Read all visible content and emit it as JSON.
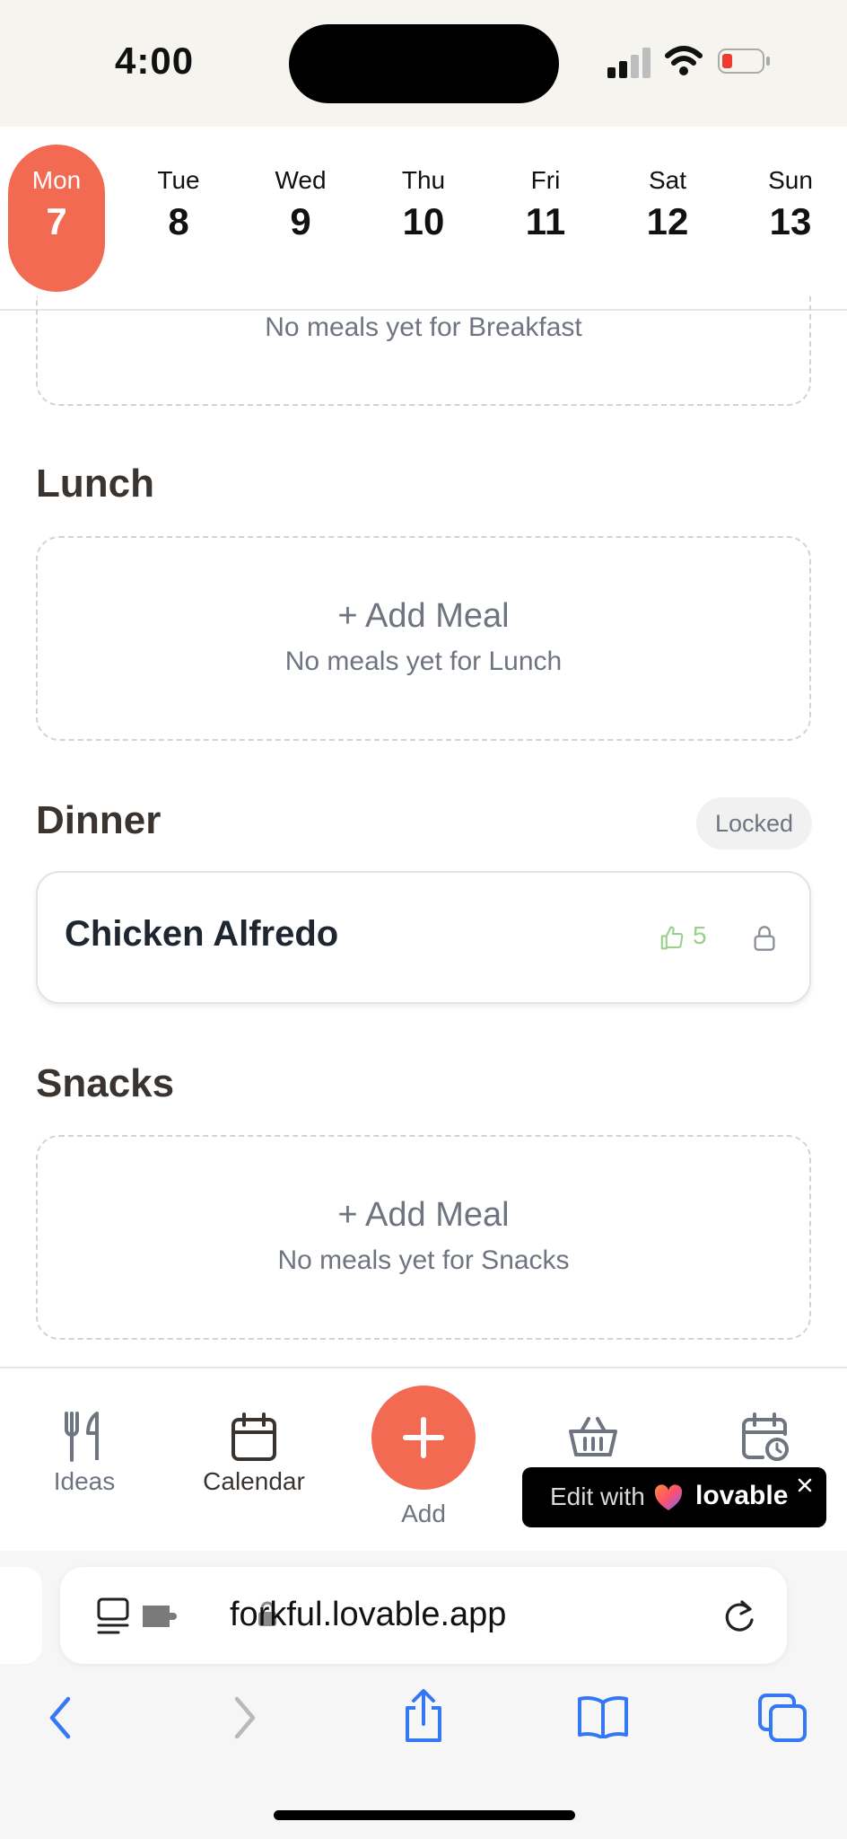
{
  "status_bar": {
    "time": "4:00"
  },
  "week": {
    "days": [
      {
        "name": "Mon",
        "num": "7",
        "active": true
      },
      {
        "name": "Tue",
        "num": "8"
      },
      {
        "name": "Wed",
        "num": "9"
      },
      {
        "name": "Thu",
        "num": "10"
      },
      {
        "name": "Fri",
        "num": "11"
      },
      {
        "name": "Sat",
        "num": "12"
      },
      {
        "name": "Sun",
        "num": "13"
      }
    ]
  },
  "breakfast": {
    "empty_text": "No meals yet for Breakfast"
  },
  "lunch": {
    "title": "Lunch",
    "add_label": "+ Add Meal",
    "empty_text": "No meals yet for Lunch"
  },
  "dinner": {
    "title": "Dinner",
    "badge": "Locked",
    "meal": {
      "name": "Chicken Alfredo",
      "likes": "5"
    }
  },
  "snacks": {
    "title": "Snacks",
    "add_label": "+ Add Meal",
    "empty_text": "No meals yet for Snacks"
  },
  "nav": {
    "ideas": "Ideas",
    "calendar": "Calendar",
    "add": "Add"
  },
  "lovable": {
    "prefix": "Edit with",
    "brand": "lovable"
  },
  "browser": {
    "url": "forkful.lovable.app"
  },
  "colors": {
    "accent": "#f26a52",
    "text_dark": "#3a3431",
    "muted": "#6e7480",
    "like_green": "#9bd08c",
    "ios_blue": "#3478f6"
  },
  "icons": [
    "cellular-signal-icon",
    "wifi-icon",
    "battery-icon",
    "thumbs-up-icon",
    "lock-icon",
    "fork-knife-icon",
    "calendar-icon",
    "plus-icon",
    "basket-icon",
    "calendar-clock-icon",
    "heart-icon",
    "close-icon",
    "reader-icon",
    "extension-icon",
    "reload-icon",
    "back-icon",
    "forward-icon",
    "share-icon",
    "bookmarks-icon",
    "tabs-icon"
  ]
}
